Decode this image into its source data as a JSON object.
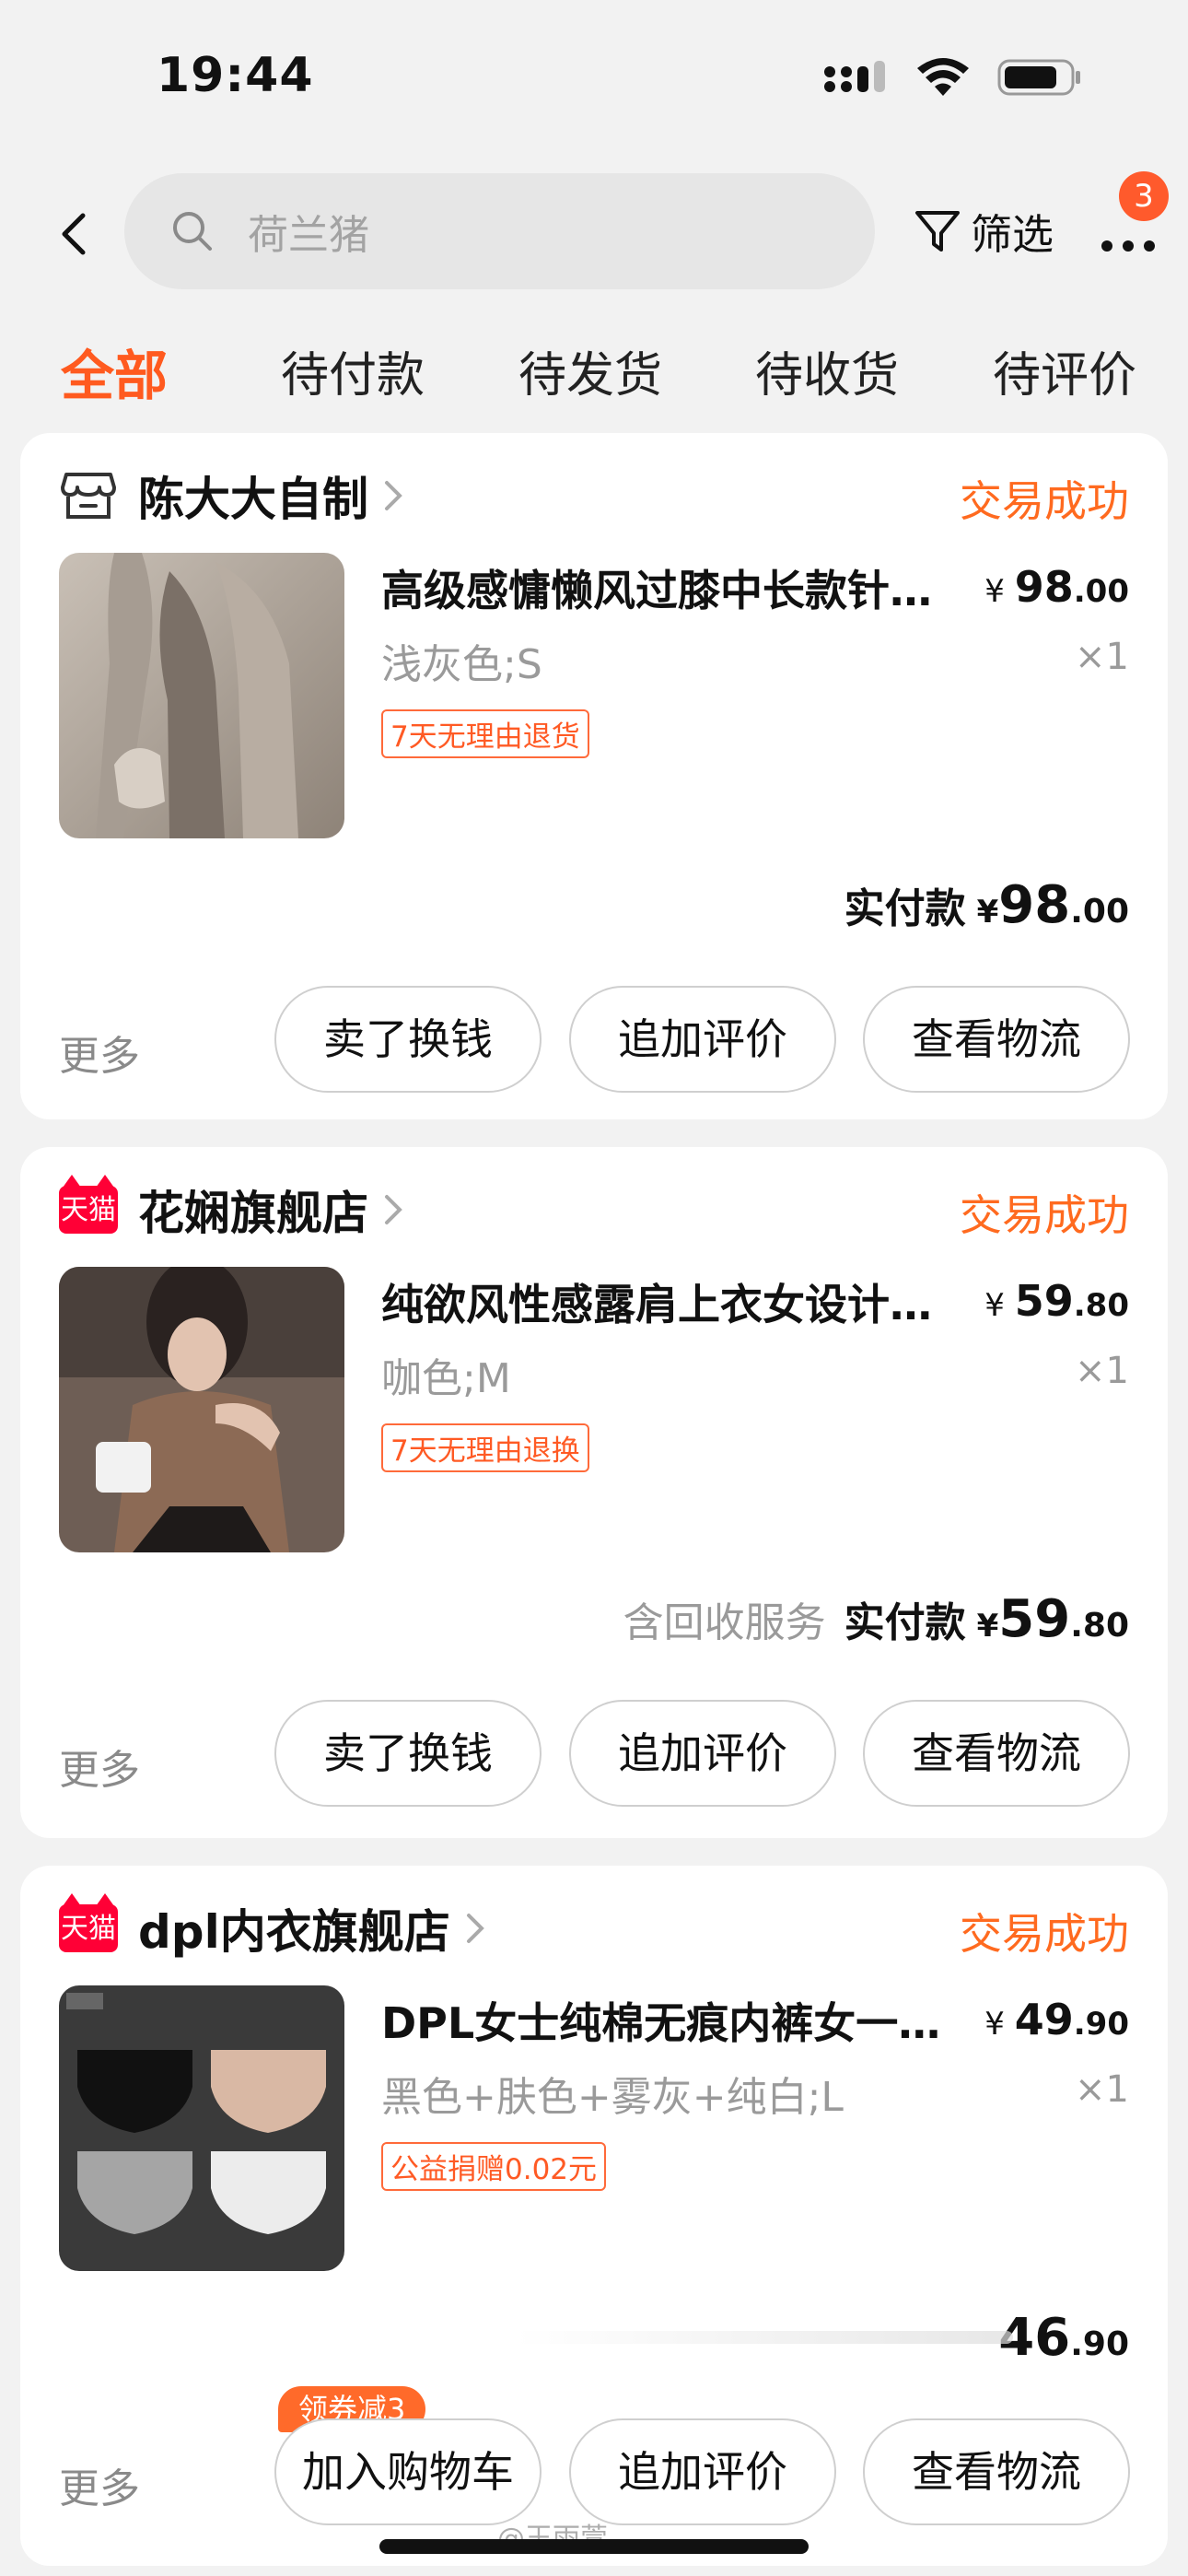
{
  "status_bar": {
    "time": "19:44"
  },
  "search": {
    "placeholder": "荷兰猪"
  },
  "header": {
    "filter_label": "筛选",
    "more_badge": "3"
  },
  "tabs": [
    {
      "label": "全部",
      "active": true
    },
    {
      "label": "待付款"
    },
    {
      "label": "待发货"
    },
    {
      "label": "待收货"
    },
    {
      "label": "待评价"
    }
  ],
  "orders": [
    {
      "shop_name": "陈大大自制",
      "shop_icon": "store-icon",
      "status": "交易成功",
      "item_title": "高级感慵懒风过膝中长款针…",
      "price_symbol": "¥",
      "price_int": "98",
      "price_dec": ".00",
      "sku": "浅灰色;S",
      "qty": "×1",
      "tag": "7天无理由退货",
      "paid_label": "实付款",
      "paid_symbol": "¥",
      "paid_int": "98",
      "paid_dec": ".00",
      "more_label": "更多",
      "buttons": [
        "卖了换钱",
        "追加评价",
        "查看物流"
      ]
    },
    {
      "shop_name": "花娴旗舰店",
      "shop_icon": "tmall-icon",
      "tmall_label": "天猫",
      "status": "交易成功",
      "item_title": "纯欲风性感露肩上衣女设计…",
      "price_symbol": "¥",
      "price_int": "59",
      "price_dec": ".80",
      "sku": "咖色;M",
      "qty": "×1",
      "tag": "7天无理由退换",
      "paid_extra": "含回收服务",
      "paid_label": "实付款",
      "paid_symbol": "¥",
      "paid_int": "59",
      "paid_dec": ".80",
      "more_label": "更多",
      "buttons": [
        "卖了换钱",
        "追加评价",
        "查看物流"
      ]
    },
    {
      "shop_name": "dpl内衣旗舰店",
      "shop_icon": "tmall-icon",
      "tmall_label": "天猫",
      "status": "交易成功",
      "item_title": "DPL女士纯棉无痕内裤女一…",
      "price_symbol": "¥",
      "price_int": "49",
      "price_dec": ".90",
      "sku": "黑色+肤色+雾灰+纯白;L",
      "qty": "×1",
      "tag": "公益捐赠0.02元",
      "paid_int": "46",
      "paid_dec": ".90",
      "more_label": "更多",
      "coupon_badge": "领券减3",
      "buttons": [
        "加入购物车",
        "追加评价",
        "查看物流"
      ]
    }
  ],
  "watermark": "@王雨萱"
}
